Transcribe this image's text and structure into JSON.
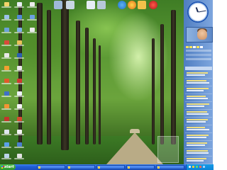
{
  "taskbar": {
    "start_label": "start",
    "tasks": [
      {
        "label": "",
        "icon": "window-icon"
      },
      {
        "label": "",
        "icon": "window-icon"
      },
      {
        "label": "",
        "icon": "window-icon"
      },
      {
        "label": "",
        "icon": "window-icon"
      },
      {
        "label": "",
        "icon": "window-icon"
      }
    ]
  },
  "sidebar": {
    "feed_title": ""
  },
  "colors": {
    "taskbar": "#215fd6",
    "start_button": "#2f922f",
    "sidebar": "#4f7ec2"
  }
}
